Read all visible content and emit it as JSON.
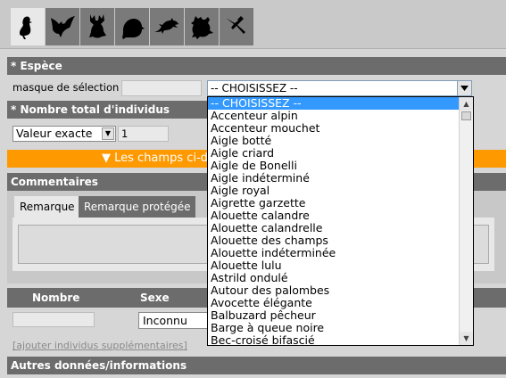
{
  "tabs": [
    {
      "icon": "bird-icon",
      "active": true
    },
    {
      "icon": "bat-icon",
      "active": false
    },
    {
      "icon": "deer-icon",
      "active": false
    },
    {
      "icon": "rodent-icon",
      "active": false
    },
    {
      "icon": "lizard-icon",
      "active": false
    },
    {
      "icon": "frog-icon",
      "active": false
    },
    {
      "icon": "dragonfly-icon",
      "active": false
    }
  ],
  "espece": {
    "heading": "* Espèce",
    "mask_label": "masque de sélection",
    "mask_value": "",
    "selected": "-- CHOISISSEZ --"
  },
  "dropdown": {
    "options": [
      "-- CHOISISSEZ --",
      "Accenteur alpin",
      "Accenteur mouchet",
      "Aigle botté",
      "Aigle criard",
      "Aigle de Bonelli",
      "Aigle indéterminé",
      "Aigle royal",
      "Aigrette garzette",
      "Alouette calandre",
      "Alouette calandrelle",
      "Alouette des champs",
      "Alouette indéterminée",
      "Alouette lulu",
      "Astrild ondulé",
      "Autour des palombes",
      "Avocette élégante",
      "Balbuzard pêcheur",
      "Barge à queue noire",
      "Bec-croisé bifascié"
    ]
  },
  "nombre_total": {
    "heading": "* Nombre total d'individus",
    "type_value": "Valeur exacte",
    "count_value": "1"
  },
  "orange_bar": {
    "text": "▼ Les champs ci-d"
  },
  "commentaires": {
    "heading": "Commentaires",
    "tab_remarque": "Remarque",
    "tab_protegee": "Remarque protégée"
  },
  "individus": {
    "col_nombre": "Nombre",
    "col_sexe": "Sexe",
    "sexe_value": "Inconnu",
    "nombre_value": "",
    "add_link": "[ajouter individus supplémentaires]"
  },
  "autres": {
    "heading": "Autres données/informations"
  },
  "colors": {
    "accent_orange": "#ff9900",
    "section_grey": "#6c6c6c",
    "selection_blue": "#3399ff"
  }
}
